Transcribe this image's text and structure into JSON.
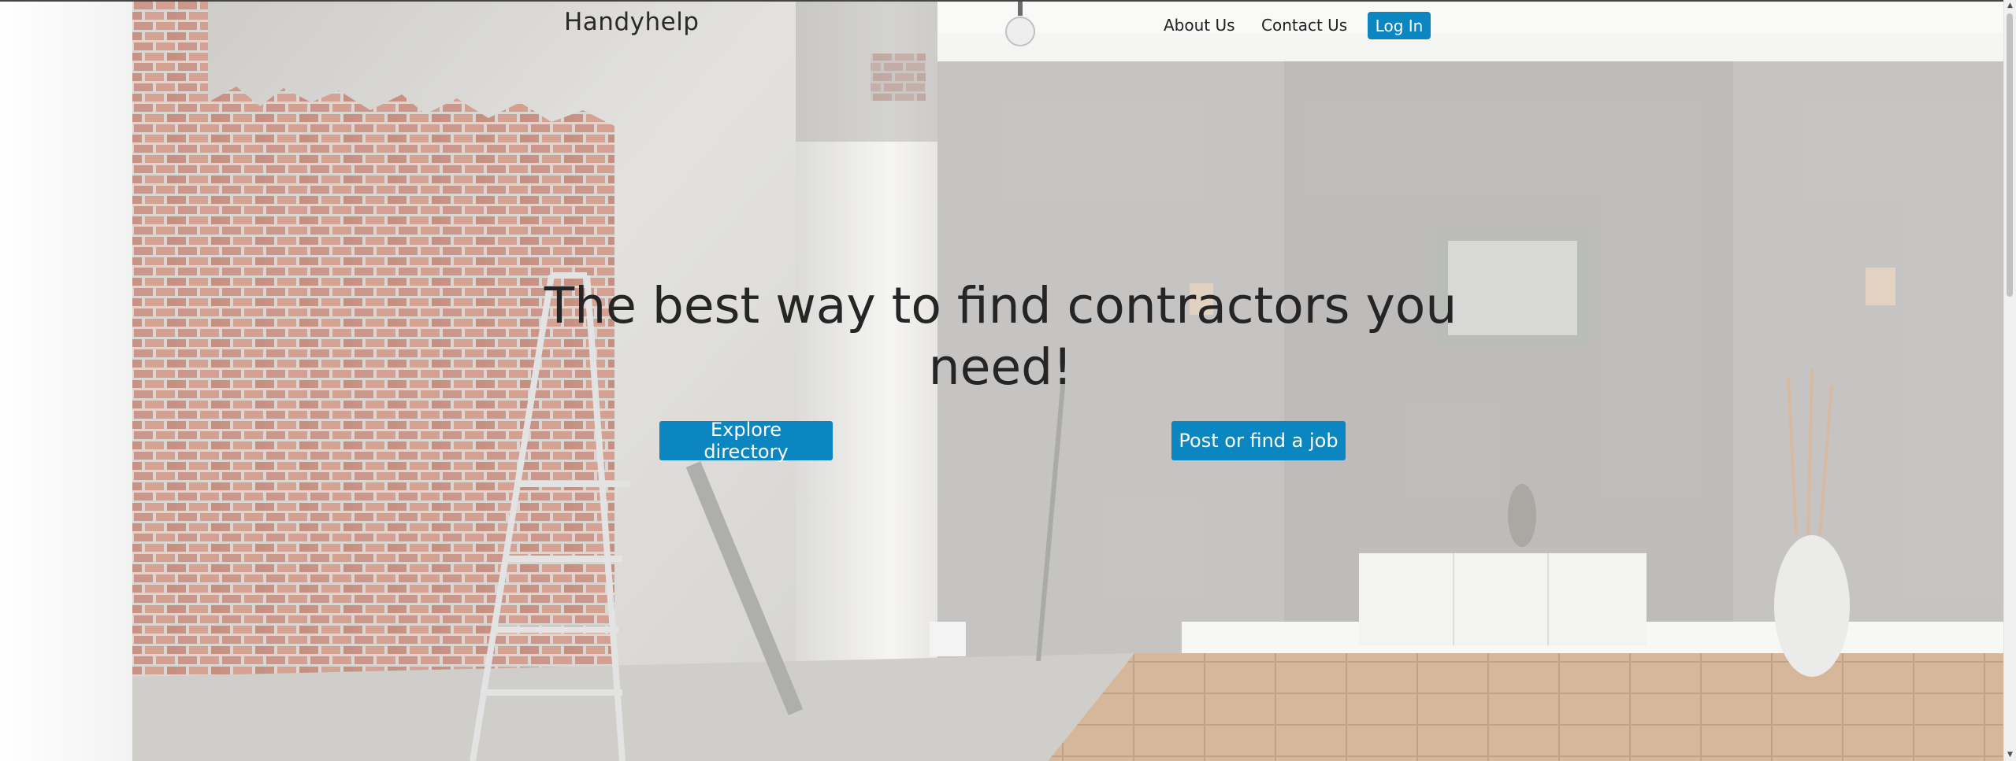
{
  "navbar": {
    "brand": "Handyhelp",
    "links": [
      {
        "label": "About Us"
      },
      {
        "label": "Contact Us"
      }
    ],
    "login_label": "Log In"
  },
  "hero": {
    "title": "The best way to find contractors you need!",
    "buttons": [
      {
        "label": "Explore directory"
      },
      {
        "label": "Post or find a job"
      }
    ],
    "background_icon": "renovation-room-photo"
  },
  "colors": {
    "accent": "#0c86c1",
    "text": "#252525"
  }
}
